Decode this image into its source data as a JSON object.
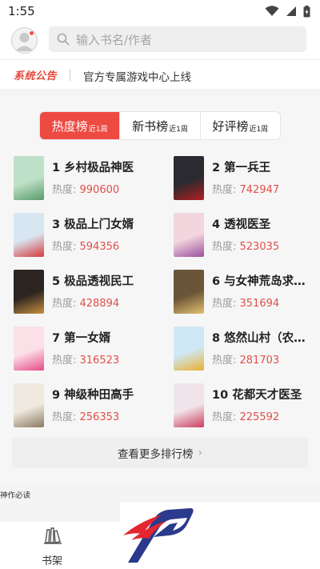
{
  "status_bar": {
    "time": "1:55"
  },
  "search": {
    "placeholder": "输入书名/作者"
  },
  "notice": {
    "tag": "系统公告",
    "text": "官方专属游戏中心上线"
  },
  "tabs": [
    {
      "label": "热度榜",
      "sub": "近1周",
      "active": true
    },
    {
      "label": "新书榜",
      "sub": "近1周",
      "active": false
    },
    {
      "label": "好评榜",
      "sub": "近1周",
      "active": false
    }
  ],
  "heat_label": "热度: ",
  "books": [
    {
      "rank_title": "1 乡村极品神医",
      "heat": "990600",
      "cover_colors": [
        "#bfe0c8",
        "#5a9a6a"
      ]
    },
    {
      "rank_title": "2 第一兵王",
      "heat": "742947",
      "cover_colors": [
        "#2a2a30",
        "#b02020"
      ]
    },
    {
      "rank_title": "3 极品上门女婿",
      "heat": "594356",
      "cover_colors": [
        "#d8e6f2",
        "#d63b3b"
      ]
    },
    {
      "rank_title": "4 透视医圣",
      "heat": "523035",
      "cover_colors": [
        "#f3d5de",
        "#9a4f9e"
      ]
    },
    {
      "rank_title": "5 极品透视民工",
      "heat": "428894",
      "cover_colors": [
        "#2b2420",
        "#c89040"
      ]
    },
    {
      "rank_title": "6 与女神荒岛求…",
      "heat": "351694",
      "cover_colors": [
        "#6b5538",
        "#e2c070"
      ]
    },
    {
      "rank_title": "7 第一女婿",
      "heat": "316523",
      "cover_colors": [
        "#fbe0e8",
        "#e84a88"
      ]
    },
    {
      "rank_title": "8 悠然山村（农…",
      "heat": "281703",
      "cover_colors": [
        "#cfe8f5",
        "#e8b030"
      ]
    },
    {
      "rank_title": "9 神级种田高手",
      "heat": "256353",
      "cover_colors": [
        "#efe9df",
        "#8a7a60"
      ]
    },
    {
      "rank_title": "10 花都天才医圣",
      "heat": "225592",
      "cover_colors": [
        "#f0e4ea",
        "#cc3d5a"
      ]
    }
  ],
  "more_rankings": "查看更多排行榜",
  "section_label": "神作必读",
  "bottom_nav": {
    "shelf_label": "书架"
  },
  "colors": {
    "accent": "#ed4a42",
    "heat_number": "#e0504a"
  }
}
